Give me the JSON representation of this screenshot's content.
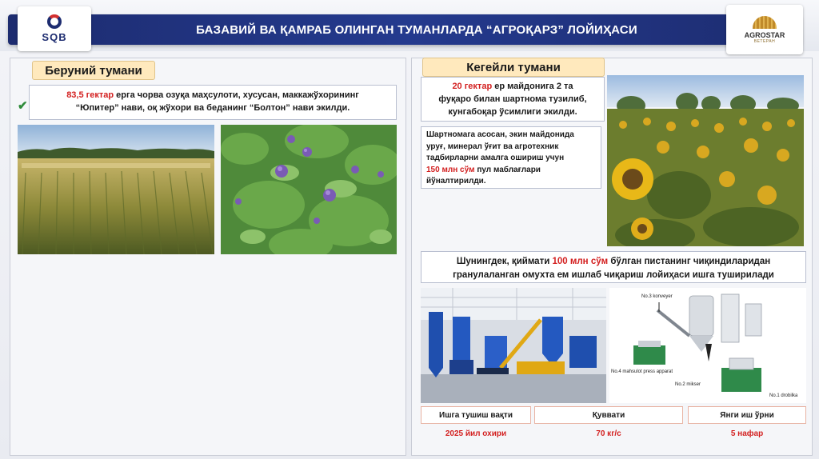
{
  "header": {
    "title": "БАЗАВИЙ ВА ҚАМРАБ ОЛИНГАН ТУМАНЛАРДА “АГРОҚАРЗ” ЛОЙИҲАСИ",
    "logo_left": "SQB",
    "logo_right": "AGROSTAR",
    "logo_right_sub": "ВЕТЕРАН"
  },
  "left": {
    "district": "Беруний тумани",
    "description_highlight": "83,5 гектар",
    "description_line1": " ерга чорва озуқа маҳсулоти, хусусан, маккажўхорининг",
    "description_line2": "“Юпитер” нави, оқ жўхори ва беданинг “Болтон” нави экилди."
  },
  "right": {
    "district": "Кегейли тумани",
    "box1_highlight": "20 гектар",
    "box1_line1": " ер майдонига 2 та",
    "box1_line2": "фуқаро билан шартнома тузилиб,",
    "box1_line3": "кунгабоқар ўсимлиги экилди.",
    "box2_line1": "Шартномага асосан, экин майдонида",
    "box2_line2": "уруғ, минерал ўғит ва агротехник",
    "box2_line3": "тадбирларни амалга ошириш учун",
    "box2_highlight": "150 млн сўм",
    "box2_line4": " пул маблағлари",
    "box2_line5": "йўналтирилди.",
    "box3_pre": "Шунингдек, қиймати ",
    "box3_highlight": "100 млн сўм",
    "box3_post": " бўлган пистанинг чиқиндиларидан",
    "box3_line2": "гранулаланган омухта ем ишлаб чиқариш лойиҳаси ишга туширилади",
    "machine_labels": {
      "konveyer": "No.3  konveyer",
      "press": "No.4 mahsulot press apparat",
      "mikser": "No.2  mikser",
      "drobilka": "No.1 drobilka"
    },
    "info": [
      {
        "label": "Ишга тушиш вақти",
        "value": "2025 йил охири"
      },
      {
        "label": "Қуввати",
        "value": "70 кг/с"
      },
      {
        "label": "Янги иш ўрни",
        "value": "5 нафар"
      }
    ]
  },
  "colors": {
    "title_bar": "#1d2c70",
    "district_tag": "#ffe9bd",
    "highlight": "#d32020",
    "check": "#2e8b3a"
  }
}
